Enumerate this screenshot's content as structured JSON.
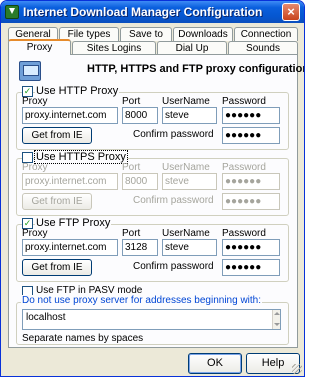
{
  "window": {
    "title": "Internet Download Manager Configuration",
    "close_glyph": "×"
  },
  "tabs": {
    "row1": [
      "General",
      "File types",
      "Save to",
      "Downloads",
      "Connection"
    ],
    "row2": [
      "Proxy",
      "Sites Logins",
      "Dial Up",
      "Sounds"
    ],
    "active": "Proxy"
  },
  "header": {
    "title": "HTTP, HTTPS and FTP proxy configuration"
  },
  "http": {
    "checkbox_label": "Use HTTP Proxy",
    "checked": true,
    "proxy_label": "Proxy",
    "proxy_value": "proxy.internet.com",
    "port_label": "Port",
    "port_value": "8000",
    "username_label": "UserName",
    "username_value": "steve",
    "password_label": "Password",
    "password_value": "●●●●●●",
    "confirm_label": "Confirm password",
    "confirm_value": "●●●●●●",
    "get_button": "Get from IE"
  },
  "https": {
    "checkbox_label": "Use HTTPS Proxy",
    "checked": false,
    "proxy_label": "Proxy",
    "proxy_value": "proxy.internet.com",
    "port_label": "Port",
    "port_value": "8000",
    "username_label": "UserName",
    "username_value": "steve",
    "password_label": "Password",
    "password_value": "●●●●●●",
    "confirm_label": "Confirm password",
    "confirm_value": "●●●●●●",
    "get_button": "Get from IE"
  },
  "ftp": {
    "checkbox_label": "Use FTP Proxy",
    "checked": true,
    "proxy_label": "Proxy",
    "proxy_value": "proxy.internet.com",
    "port_label": "Port",
    "port_value": "3128",
    "username_label": "UserName",
    "username_value": "steve",
    "password_label": "Password",
    "password_value": "●●●●●●",
    "confirm_label": "Confirm password",
    "confirm_value": "●●●●●●",
    "get_button": "Get from IE"
  },
  "pasv": {
    "label": "Use FTP in PASV mode",
    "checked": false
  },
  "exclusions": {
    "label": "Do not use proxy server for addresses beginning with:",
    "value": "localhost",
    "hint": "Separate names by spaces"
  },
  "buttons": {
    "ok": "OK",
    "help": "Help"
  },
  "colors": {
    "title_bar": "#0a5fdd",
    "active_tab_accent": "#e68b2c",
    "group_label": "#0046d5"
  }
}
